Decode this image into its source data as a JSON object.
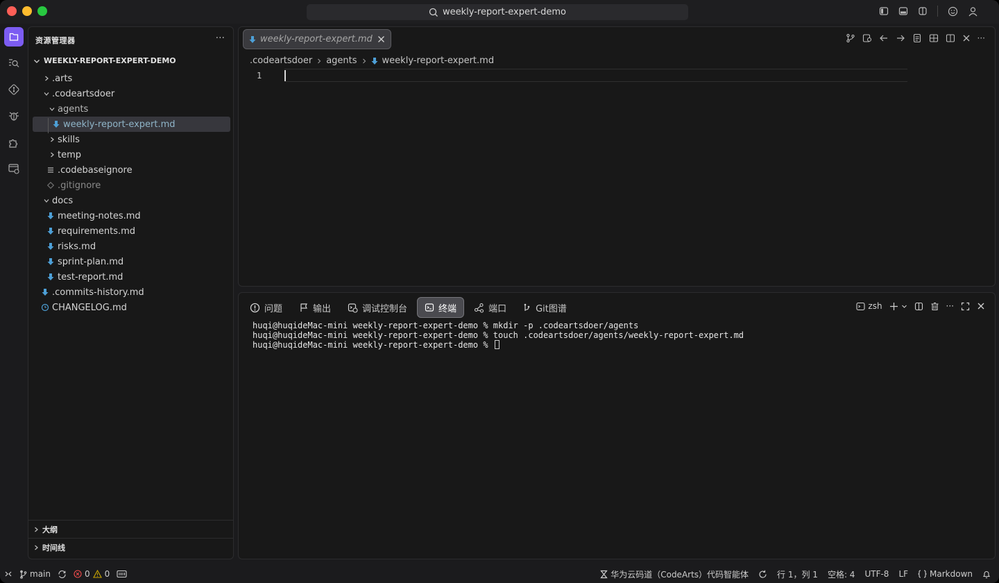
{
  "window": {
    "title": "weekly-report-expert-demo"
  },
  "colors": {
    "accent": "#7c5cf2",
    "markdown_icon": "#4d9fd6",
    "error": "#f14c4c",
    "warning": "#cca700"
  },
  "sidebar": {
    "title": "资源管理器",
    "more": "···",
    "project": "WEEKLY-REPORT-EXPERT-DEMO",
    "tree": [
      {
        "label": ".arts",
        "type": "folder",
        "expanded": false
      },
      {
        "label": ".codeartsdoer",
        "type": "folder",
        "expanded": true
      },
      {
        "label": "agents",
        "type": "folder",
        "expanded": true
      },
      {
        "label": "weekly-report-expert.md",
        "type": "markdown",
        "selected": true
      },
      {
        "label": "skills",
        "type": "folder",
        "expanded": false
      },
      {
        "label": "temp",
        "type": "folder",
        "expanded": false
      },
      {
        "label": ".codebaseignore",
        "type": "lines"
      },
      {
        "label": ".gitignore",
        "type": "git"
      },
      {
        "label": "docs",
        "type": "folder",
        "expanded": true
      },
      {
        "label": "meeting-notes.md",
        "type": "markdown"
      },
      {
        "label": "requirements.md",
        "type": "markdown"
      },
      {
        "label": "risks.md",
        "type": "markdown"
      },
      {
        "label": "sprint-plan.md",
        "type": "markdown"
      },
      {
        "label": "test-report.md",
        "type": "markdown"
      },
      {
        "label": ".commits-history.md",
        "type": "markdown"
      },
      {
        "label": "CHANGELOG.md",
        "type": "clock"
      }
    ],
    "sections": [
      "大纲",
      "时间线"
    ]
  },
  "editor": {
    "tab_label": "weekly-report-expert.md",
    "breadcrumb": [
      ".codeartsdoer",
      "agents",
      "weekly-report-expert.md"
    ],
    "line_number": "1"
  },
  "panel": {
    "tabs": [
      "问题",
      "输出",
      "调试控制台",
      "终端",
      "端口",
      "Git图谱"
    ],
    "active_tab": "终端",
    "shell": "zsh",
    "terminal_lines": [
      "huqi@huqideMac-mini weekly-report-expert-demo % mkdir -p .codeartsdoer/agents",
      "huqi@huqideMac-mini weekly-report-expert-demo % touch .codeartsdoer/agents/weekly-report-expert.md",
      "huqi@huqideMac-mini weekly-report-expert-demo % "
    ]
  },
  "statusbar": {
    "branch": "main",
    "errors": "0",
    "warnings": "0",
    "assistant": "华为云码道（CodeArts）代码智能体",
    "position": "行 1，列 1",
    "spaces": "空格: 4",
    "encoding": "UTF-8",
    "eol": "LF",
    "language": "Markdown"
  }
}
